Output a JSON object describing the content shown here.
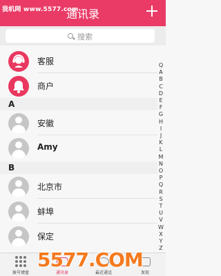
{
  "watermark": "我机网 www.5577.com",
  "header": {
    "title": "通讯录"
  },
  "search": {
    "placeholder": "搜索"
  },
  "top_items": [
    {
      "name": "客服"
    },
    {
      "name": "商户"
    }
  ],
  "sections": [
    {
      "letter": "A",
      "contacts": [
        {
          "name": "安徽"
        },
        {
          "name": "Amy"
        }
      ]
    },
    {
      "letter": "B",
      "contacts": [
        {
          "name": "北京市"
        },
        {
          "name": "蚌埠"
        },
        {
          "name": "保定"
        }
      ]
    }
  ],
  "index_letters": [
    "Q",
    "A",
    "B",
    "C",
    "D",
    "E",
    "F",
    "G",
    "H",
    "I",
    "J",
    "K",
    "L",
    "M",
    "N",
    "O",
    "P",
    "Q",
    "R",
    "S",
    "T",
    "U",
    "V",
    "W",
    "X",
    "Y",
    "Z",
    "#"
  ],
  "tabs": [
    {
      "label": "拨号键盘"
    },
    {
      "label": "通讯录"
    },
    {
      "label": "最近通话"
    },
    {
      "label": "发现"
    }
  ],
  "logo": "5577.COM",
  "colors": {
    "accent": "#ea3b67",
    "logo": "#f47a1f"
  }
}
